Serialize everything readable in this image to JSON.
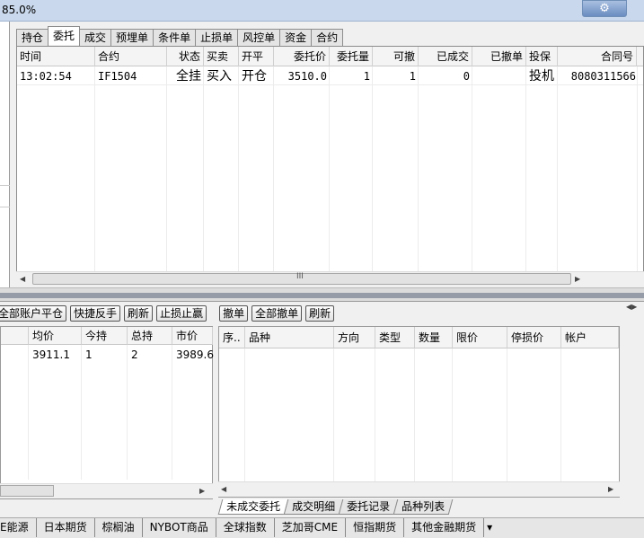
{
  "title_bar": {
    "zoom": "85.0%",
    "settings_icon": "gear-icon"
  },
  "top_tabs": [
    "持仓",
    "委托",
    "成交",
    "预埋单",
    "条件单",
    "止损单",
    "风控单",
    "资金",
    "合约"
  ],
  "top_tabs_active": 1,
  "order_grid": {
    "columns": [
      "时间",
      "合约",
      "状态",
      "买卖",
      "开平",
      "委托价",
      "委托量",
      "可撤",
      "已成交",
      "已撤单",
      "投保",
      "合同号"
    ],
    "rows": [
      [
        "13:02:54",
        "IF1504",
        "全挂",
        "买入",
        "开仓",
        "3510.0",
        "1",
        "1",
        "0",
        "",
        "投机",
        "8080311566"
      ]
    ]
  },
  "scroll_grip": "III",
  "toolbar": [
    "全部账户平仓",
    "快捷反手",
    "刷新",
    "止损止赢",
    "撤单",
    "全部撤单",
    "刷新"
  ],
  "position_list": {
    "columns": [
      "均价",
      "今持",
      "总持",
      "市价"
    ],
    "rows": [
      [
        "3911.1",
        "1",
        "2",
        "3989.6"
      ]
    ]
  },
  "pending_list": {
    "columns": [
      "序..",
      "品种",
      "方向",
      "类型",
      "数量",
      "限价",
      "停损价",
      "帐户"
    ]
  },
  "sub_tabs": [
    "未成交委托",
    "成交明细",
    "委托记录",
    "品种列表"
  ],
  "sub_tabs_active": 0,
  "bottom_tabs": [
    "E能源",
    "日本期货",
    "棕榈油",
    "NYBOT商品",
    "全球指数",
    "芝加哥CME",
    "恒指期货",
    "其他金融期货"
  ]
}
